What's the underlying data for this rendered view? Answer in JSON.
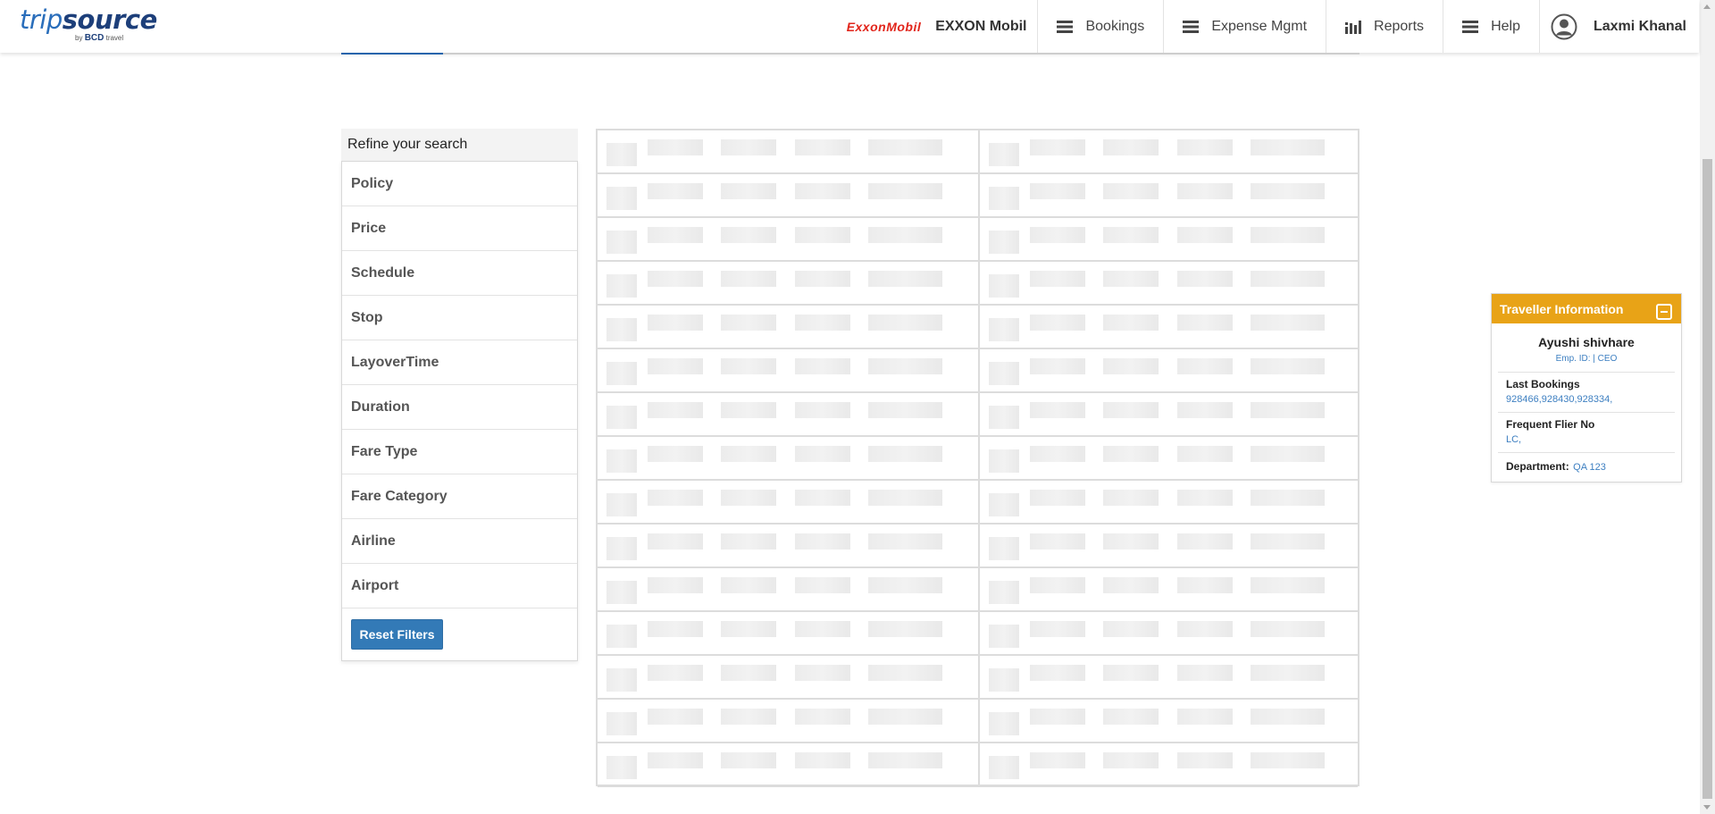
{
  "header": {
    "logo_text_a": "trip",
    "logo_text_b": "source",
    "logo_sub_by": "by",
    "logo_sub_bcd": "BCD",
    "logo_sub_travel": "travel",
    "company_logo_text": "ExxonMobil",
    "company_name": "EXXON Mobil",
    "nav_items": [
      {
        "label": "Bookings",
        "icon": "menu-icon"
      },
      {
        "label": "Expense Mgmt",
        "icon": "menu-icon"
      },
      {
        "label": "Reports",
        "icon": "bar-chart-icon"
      },
      {
        "label": "Help",
        "icon": "menu-icon"
      }
    ],
    "user_name": "Laxmi Khanal"
  },
  "filters": {
    "title": "Refine your search",
    "items": [
      "Policy",
      "Price",
      "Schedule",
      "Stop",
      "LayoverTime",
      "Duration",
      "Fare Type",
      "Fare Category",
      "Airline",
      "Airport"
    ],
    "reset_label": "Reset Filters"
  },
  "traveller": {
    "heading": "Traveller Information",
    "name": "Ayushi shivhare",
    "emp_line": "Emp. ID: | CEO",
    "last_bookings_label": "Last Bookings",
    "last_bookings_value": "928466,928430,928334,",
    "frequent_flier_label": "Frequent Flier No",
    "frequent_flier_value": "LC,",
    "department_label": "Department",
    "department_value": "QA 123"
  },
  "colors": {
    "brand_blue": "#2a6ebb",
    "accent_orange": "#e8a317",
    "button_blue": "#337ab7",
    "link_blue": "#3d7fc1"
  }
}
